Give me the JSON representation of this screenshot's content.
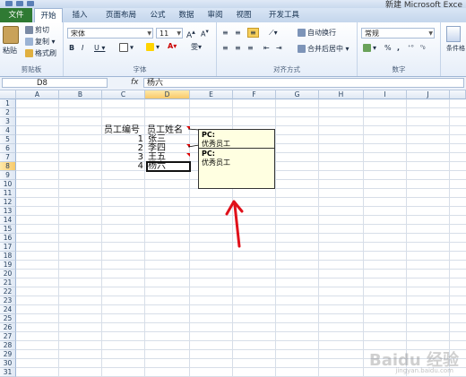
{
  "window": {
    "title": "新建 Microsoft Exce"
  },
  "tabs": [
    {
      "label": "文件"
    },
    {
      "label": "开始"
    },
    {
      "label": "插入"
    },
    {
      "label": "页面布局"
    },
    {
      "label": "公式"
    },
    {
      "label": "数据"
    },
    {
      "label": "审阅"
    },
    {
      "label": "视图"
    },
    {
      "label": "开发工具"
    }
  ],
  "ribbon": {
    "clipboard": {
      "paste": "粘贴",
      "cut": "剪切",
      "copy": "复制 ▾",
      "format_painter": "格式刷",
      "label": "剪贴板"
    },
    "font": {
      "name": "宋体",
      "size": "11",
      "bold": "B",
      "italic": "I",
      "underline": "U ▾",
      "label": "字体"
    },
    "alignment": {
      "wrap": "自动换行",
      "merge": "合并后居中 ▾",
      "label": "对齐方式"
    },
    "number": {
      "format": "常规",
      "percent": "%",
      "comma": ",",
      "label": "数字"
    },
    "styles": {
      "conditional": "条件格"
    }
  },
  "formula_bar": {
    "name_box": "D8",
    "fx": "fx",
    "value": "杨六"
  },
  "columns": [
    "A",
    "B",
    "C",
    "D",
    "E",
    "F",
    "G",
    "H",
    "I",
    "J"
  ],
  "rows": [
    "1",
    "2",
    "3",
    "4",
    "5",
    "6",
    "7",
    "8",
    "9",
    "10",
    "11",
    "12",
    "13",
    "14",
    "15",
    "16",
    "17",
    "18",
    "19",
    "20",
    "21",
    "22",
    "23",
    "24",
    "25",
    "26",
    "27",
    "28",
    "29",
    "30",
    "31"
  ],
  "cells": {
    "C4": "员工编号",
    "D4": "员工姓名",
    "C5": "1",
    "D5": "张三",
    "C6": "2",
    "D6": "李四",
    "C7": "3",
    "D7": "王五",
    "C8": "4",
    "D8": "杨六"
  },
  "comments": [
    {
      "author": "PC:",
      "text": "优秀员工"
    },
    {
      "author": "PC:",
      "text": "优秀员工"
    }
  ],
  "watermark": {
    "brand": "Baidu 经验",
    "url": "jingyan.baidu.com"
  },
  "colors": {
    "file_tab": "#2f7a33",
    "arrow": "#e0101a",
    "comment_bg": "#ffffe1"
  }
}
